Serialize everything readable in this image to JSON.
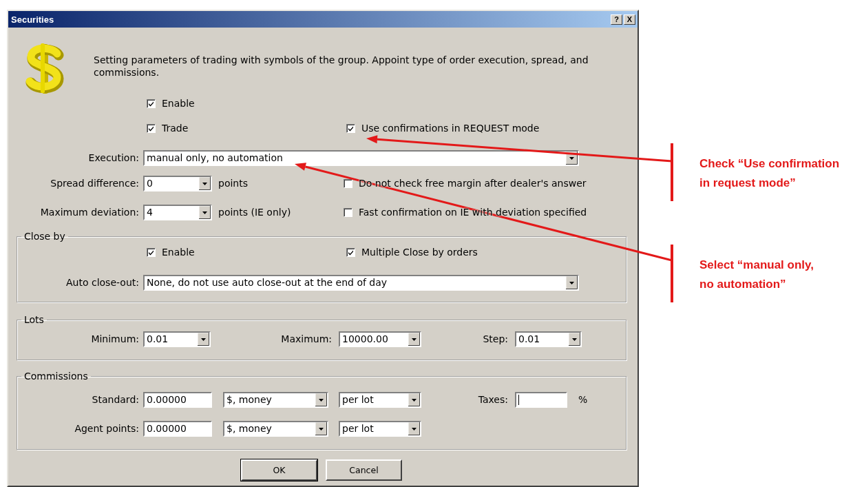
{
  "window": {
    "title": "Securities",
    "help_button": "?",
    "close_button": "X"
  },
  "description": "Setting parameters of trading with symbols of the group. Appoint type of order execution, spread, and commissions.",
  "general": {
    "enable": {
      "label": "Enable",
      "checked": true
    },
    "trade": {
      "label": "Trade",
      "checked": true
    },
    "use_confirmations": {
      "label": "Use confirmations in REQUEST mode",
      "checked": true
    },
    "execution": {
      "label": "Execution:",
      "value": "manual only, no automation"
    },
    "spread_difference": {
      "label": "Spread difference:",
      "value": "0",
      "unit": "points"
    },
    "no_free_margin_check": {
      "label": "Do not check free margin after dealer's answer",
      "checked": false
    },
    "maximum_deviation": {
      "label": "Maximum deviation:",
      "value": "4",
      "unit": "points (IE only)"
    },
    "fast_confirmation": {
      "label": "Fast confirmation on IE with deviation specified",
      "checked": false
    }
  },
  "close_by": {
    "title": "Close by",
    "enable": {
      "label": "Enable",
      "checked": true
    },
    "multiple_close": {
      "label": "Multiple Close by orders",
      "checked": true
    },
    "auto_close_out": {
      "label": "Auto close-out:",
      "value": "None,  do not use auto close-out at the end of day"
    }
  },
  "lots": {
    "title": "Lots",
    "fields": [
      {
        "label": "Minimum:",
        "value": "0.01"
      },
      {
        "label": "Maximum:",
        "value": "10000.00"
      },
      {
        "label": "Step:",
        "value": "0.01"
      }
    ]
  },
  "commissions": {
    "title": "Commissions",
    "standard": {
      "label": "Standard:",
      "value": "0.00000",
      "currency": "$, money",
      "basis": "per lot"
    },
    "taxes": {
      "label": "Taxes:",
      "unit": "%"
    },
    "agent": {
      "label": "Agent points:",
      "value": "0.00000",
      "currency": "$, money",
      "basis": "per lot"
    }
  },
  "buttons": [
    {
      "label": "OK",
      "default": true
    },
    {
      "label": "Cancel",
      "default": false
    }
  ],
  "annotations": [
    {
      "text": "Check “Use confirmation\nin request mode”"
    },
    {
      "text": "Select “manual only,\nno automation”"
    }
  ]
}
